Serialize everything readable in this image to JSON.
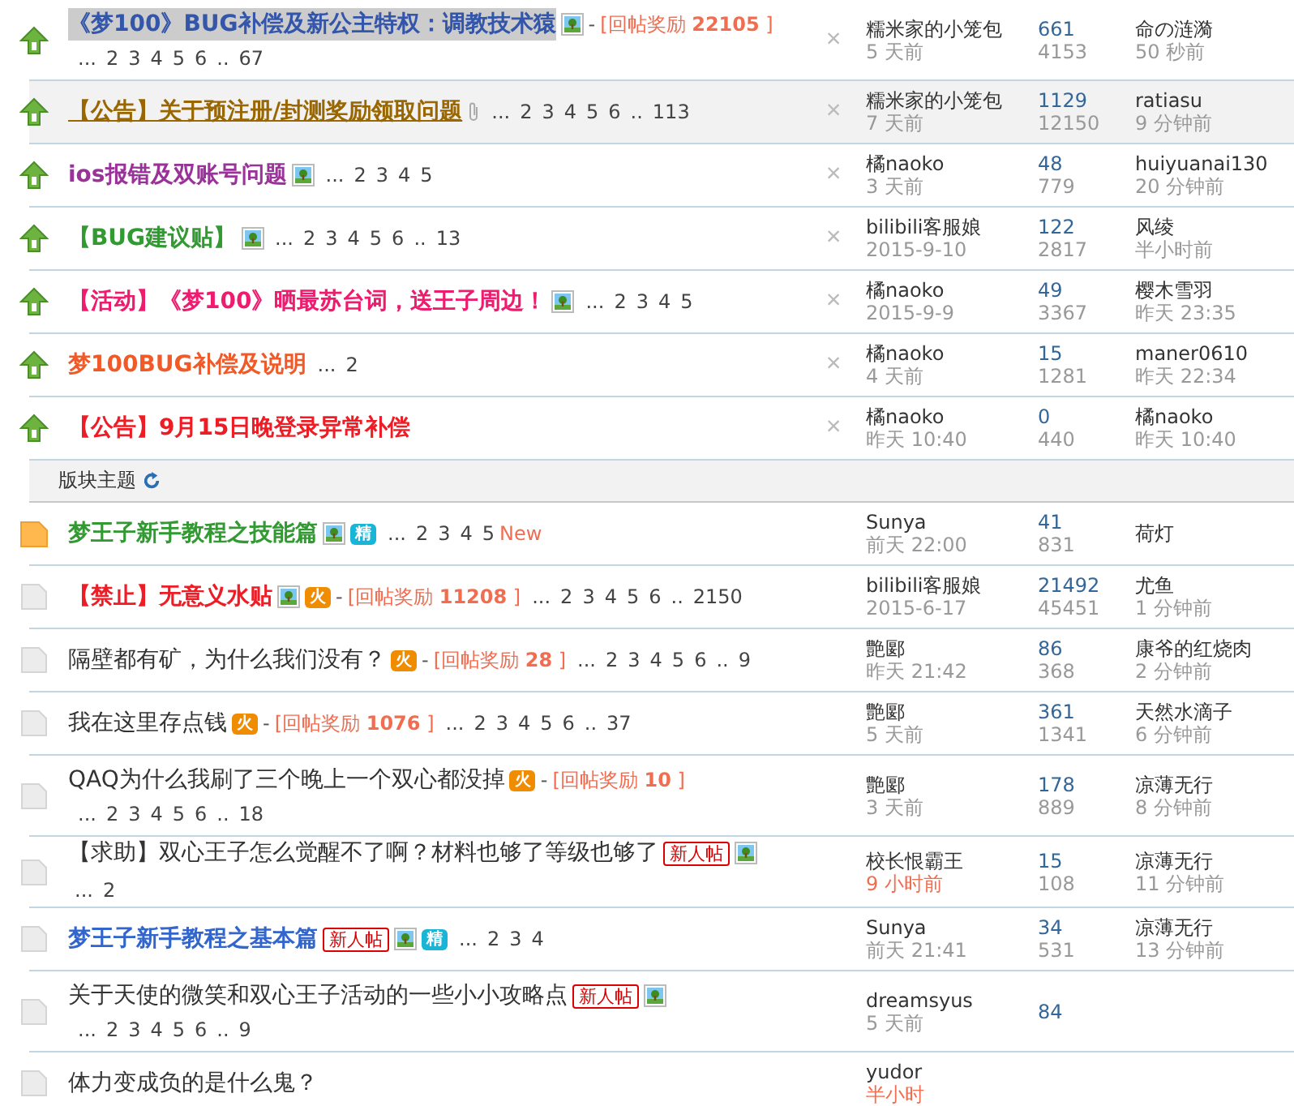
{
  "pinned_threads": [
    {
      "kind": "pinned",
      "title": "《梦100》BUG补偿及新公主特权：调教技术猿",
      "color": "#3355aa",
      "bold": true,
      "highlighted": true,
      "underlined": false,
      "row_shaded": false,
      "extras": [
        {
          "kind": "image"
        },
        {
          "kind": "reward",
          "dash": "-",
          "label": "[回帖奖励",
          "amount": "22105",
          "close": "]"
        }
      ],
      "pages": [
        "...",
        "2",
        "3",
        "4",
        "5",
        "6",
        "..",
        "67"
      ],
      "pages_newline": true,
      "delete": "×",
      "author": "糯米家的小笼包",
      "posted": "5 天前",
      "posted_recent": false,
      "replies": "661",
      "views": "4153",
      "last_poster": "命の涟漪",
      "last_time": "50 秒前"
    },
    {
      "kind": "pinned",
      "title": "【公告】关于预注册/封测奖励领取问题",
      "color": "#996600",
      "bold": true,
      "highlighted": false,
      "underlined": true,
      "row_shaded": true,
      "extras": [
        {
          "kind": "attachment"
        }
      ],
      "pages": [
        "...",
        "2",
        "3",
        "4",
        "5",
        "6",
        "..",
        "113"
      ],
      "pages_newline": false,
      "delete": "×",
      "author": "糯米家的小笼包",
      "posted": "7 天前",
      "posted_recent": false,
      "replies": "1129",
      "views": "12150",
      "last_poster": "ratiasu",
      "last_time": "9 分钟前"
    },
    {
      "kind": "pinned",
      "title": "ios报错及双账号问题",
      "color": "#993399",
      "bold": true,
      "highlighted": false,
      "underlined": false,
      "row_shaded": false,
      "extras": [
        {
          "kind": "image"
        }
      ],
      "pages": [
        "...",
        "2",
        "3",
        "4",
        "5"
      ],
      "pages_newline": false,
      "delete": "×",
      "author": "橘naoko",
      "posted": "3 天前",
      "posted_recent": false,
      "replies": "48",
      "views": "779",
      "last_poster": "huiyuanai130",
      "last_time": "20 分钟前"
    },
    {
      "kind": "pinned",
      "title": "【BUG建议贴】",
      "color": "#339933",
      "bold": true,
      "highlighted": false,
      "underlined": false,
      "row_shaded": false,
      "extras": [
        {
          "kind": "image"
        }
      ],
      "pages": [
        "...",
        "2",
        "3",
        "4",
        "5",
        "6",
        "..",
        "13"
      ],
      "pages_newline": false,
      "delete": "×",
      "author": "bilibili客服娘",
      "posted": "2015-9-10",
      "posted_recent": false,
      "replies": "122",
      "views": "2817",
      "last_poster": "风绫",
      "last_time": "半小时前"
    },
    {
      "kind": "pinned",
      "title": "【活动】《梦100》晒最苏台词，送王子周边！",
      "color": "#ee1b6f",
      "bold": true,
      "highlighted": false,
      "underlined": false,
      "row_shaded": false,
      "extras": [
        {
          "kind": "image"
        }
      ],
      "pages": [
        "...",
        "2",
        "3",
        "4",
        "5"
      ],
      "pages_newline": false,
      "delete": "×",
      "author": "橘naoko",
      "posted": "2015-9-9",
      "posted_recent": false,
      "replies": "49",
      "views": "3367",
      "last_poster": "樱木雪羽",
      "last_time": "昨天 23:35"
    },
    {
      "kind": "pinned",
      "title": "梦100BUG补偿及说明",
      "color": "#f05a28",
      "bold": true,
      "highlighted": false,
      "underlined": false,
      "row_shaded": false,
      "pages": [
        "...",
        "2"
      ],
      "pages_newline": false,
      "delete": "×",
      "author": "橘naoko",
      "posted": "4 天前",
      "posted_recent": false,
      "replies": "15",
      "views": "1281",
      "last_poster": "maner0610",
      "last_time": "昨天 22:34"
    },
    {
      "kind": "pinned",
      "title": "【公告】9月15日晚登录异常补偿",
      "color": "#ee1c25",
      "bold": true,
      "highlighted": false,
      "underlined": false,
      "row_shaded": false,
      "pages_newline": false,
      "delete": "×",
      "author": "橘naoko",
      "posted": "昨天 10:40",
      "posted_recent": false,
      "replies": "0",
      "views": "440",
      "last_poster": "橘naoko",
      "last_time": "昨天 10:40"
    }
  ],
  "section": {
    "title": "版块主题"
  },
  "threads": [
    {
      "kind": "new",
      "title": "梦王子新手教程之技能篇",
      "color": "#339933",
      "bold": true,
      "highlighted": false,
      "underlined": false,
      "row_shaded": false,
      "extras": [
        {
          "kind": "image"
        },
        {
          "kind": "digest",
          "text": "精"
        }
      ],
      "pages": [
        "...",
        "2",
        "3",
        "4",
        "5"
      ],
      "new_label": "New",
      "pages_newline": false,
      "author": "Sunya",
      "posted": "前天 22:00",
      "posted_recent": false,
      "replies": "41",
      "views": "831",
      "last_poster": "荷灯"
    },
    {
      "kind": "normal",
      "title": "【禁止】无意义水贴",
      "color": "#ee1c25",
      "bold": true,
      "highlighted": false,
      "underlined": false,
      "row_shaded": false,
      "extras": [
        {
          "kind": "image"
        },
        {
          "kind": "hot",
          "text": "火"
        },
        {
          "kind": "reward",
          "dash": "-",
          "label": "[回帖奖励",
          "amount": "11208",
          "close": "]"
        }
      ],
      "pages": [
        "...",
        "2",
        "3",
        "4",
        "5",
        "6",
        "..",
        "2150"
      ],
      "pages_newline": false,
      "author": "bilibili客服娘",
      "posted": "2015-6-17",
      "posted_recent": false,
      "replies": "21492",
      "views": "45451",
      "last_poster": "尤鱼",
      "last_time": "1 分钟前"
    },
    {
      "kind": "normal",
      "title": "隔壁都有矿，为什么我们没有？",
      "color": "#333333",
      "bold": false,
      "highlighted": false,
      "underlined": false,
      "row_shaded": false,
      "extras": [
        {
          "kind": "hot",
          "text": "火"
        },
        {
          "kind": "reward",
          "dash": "-",
          "label": "[回帖奖励",
          "amount": "28",
          "close": "]"
        }
      ],
      "pages": [
        "...",
        "2",
        "3",
        "4",
        "5",
        "6",
        "..",
        "9"
      ],
      "pages_newline": false,
      "author": "艶郾",
      "posted": "昨天 21:42",
      "posted_recent": false,
      "replies": "86",
      "views": "368",
      "last_poster": "康爷的红烧肉",
      "last_time": "2 分钟前"
    },
    {
      "kind": "normal",
      "title": "我在这里存点钱",
      "color": "#333333",
      "bold": false,
      "highlighted": false,
      "underlined": false,
      "row_shaded": false,
      "extras": [
        {
          "kind": "hot",
          "text": "火"
        },
        {
          "kind": "reward",
          "dash": "-",
          "label": "[回帖奖励",
          "amount": "1076",
          "close": "]"
        }
      ],
      "pages": [
        "...",
        "2",
        "3",
        "4",
        "5",
        "6",
        "..",
        "37"
      ],
      "pages_newline": false,
      "author": "艶郾",
      "posted": "5 天前",
      "posted_recent": false,
      "replies": "361",
      "views": "1341",
      "last_poster": "天然水滴子",
      "last_time": "6 分钟前"
    },
    {
      "kind": "normal",
      "title": "QAQ为什么我刷了三个晚上一个双心都没掉",
      "color": "#333333",
      "bold": false,
      "highlighted": false,
      "underlined": false,
      "row_shaded": false,
      "extras": [
        {
          "kind": "hot",
          "text": "火"
        },
        {
          "kind": "reward",
          "dash": "-",
          "label": "[回帖奖励",
          "amount": "10",
          "close": "]"
        }
      ],
      "pages": [
        "...",
        "2",
        "3",
        "4",
        "5",
        "6",
        "..",
        "18"
      ],
      "pages_newline": true,
      "author": "艶郾",
      "posted": "3 天前",
      "posted_recent": false,
      "replies": "178",
      "views": "889",
      "last_poster": "凉薄无行",
      "last_time": "8 分钟前"
    },
    {
      "kind": "normal",
      "title": "【求助】双心王子怎么觉醒不了啊？材料也够了等级也够了",
      "color": "#333333",
      "bold": false,
      "highlighted": false,
      "underlined": false,
      "row_shaded": false,
      "extras": [
        {
          "kind": "newbie",
          "text": "新人帖"
        },
        {
          "kind": "image"
        }
      ],
      "pages": [
        "...",
        "2"
      ],
      "pages_newline": false,
      "author": "校长恨霸王",
      "posted": "9 小时前",
      "posted_recent": true,
      "replies": "15",
      "views": "108",
      "last_poster": "凉薄无行",
      "last_time": "11 分钟前"
    },
    {
      "kind": "normal",
      "title": "梦王子新手教程之基本篇",
      "color": "#3366cc",
      "bold": true,
      "highlighted": false,
      "underlined": false,
      "row_shaded": false,
      "extras": [
        {
          "kind": "newbie",
          "text": "新人帖"
        },
        {
          "kind": "image"
        },
        {
          "kind": "digest",
          "text": "精"
        }
      ],
      "pages": [
        "...",
        "2",
        "3",
        "4"
      ],
      "pages_newline": false,
      "author": "Sunya",
      "posted": "前天 21:41",
      "posted_recent": false,
      "replies": "34",
      "views": "531",
      "last_poster": "凉薄无行",
      "last_time": "13 分钟前"
    },
    {
      "kind": "normal",
      "title": "关于天使的微笑和双心王子活动的一些小小攻略点",
      "color": "#333333",
      "bold": false,
      "highlighted": false,
      "underlined": false,
      "row_shaded": false,
      "extras": [
        {
          "kind": "newbie",
          "text": "新人帖"
        },
        {
          "kind": "image"
        }
      ],
      "pages": [
        "...",
        "2",
        "3",
        "4",
        "5",
        "6",
        "..",
        "9"
      ],
      "pages_newline": true,
      "author": "dreamsyus",
      "posted": "5 天前",
      "posted_recent": false,
      "replies": "84"
    },
    {
      "kind": "normal",
      "title": "体力变成负的是什么鬼？",
      "color": "#333333",
      "bold": false,
      "highlighted": false,
      "underlined": false,
      "row_shaded": false,
      "pages_newline": false,
      "author": "yudor",
      "posted": "半小时",
      "posted_recent": true
    }
  ]
}
